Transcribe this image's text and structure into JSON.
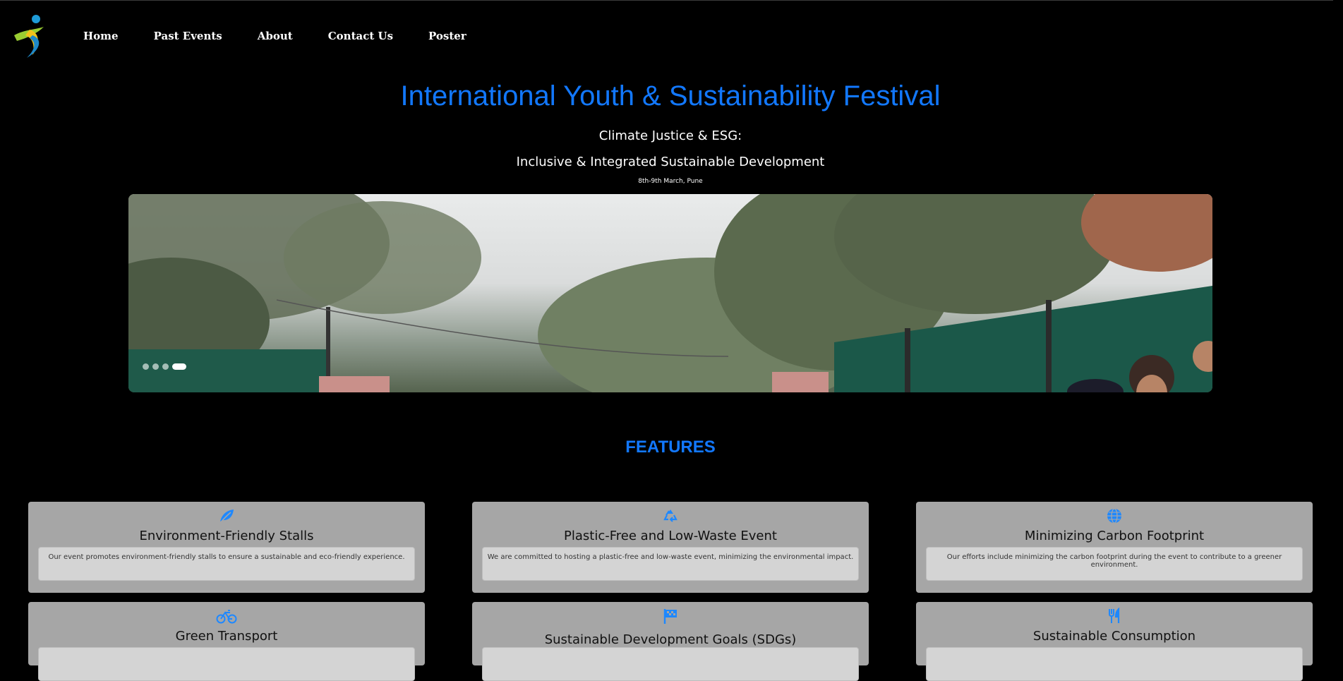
{
  "nav": {
    "links": [
      "Home",
      "Past Events",
      "About",
      "Contact Us",
      "Poster"
    ]
  },
  "hero": {
    "title": "International Youth & Sustainability Festival",
    "subtitle1": "Climate Justice & ESG:",
    "subtitle2": "Inclusive & Integrated Sustainable Development",
    "date": "8th-9th March, Pune"
  },
  "carousel": {
    "slide_count": 4,
    "active_index": 3
  },
  "features": {
    "heading": "FEATURES",
    "accent_color": "#1278ff",
    "items": [
      {
        "icon": "leaf-icon",
        "title": "Environment-Friendly Stalls",
        "desc": "Our event promotes environment-friendly stalls to ensure a sustainable and eco-friendly experience."
      },
      {
        "icon": "recycle-icon",
        "title": "Plastic-Free and Low-Waste Event",
        "desc": "We are committed to hosting a plastic-free and low-waste event, minimizing the environmental impact."
      },
      {
        "icon": "globe-icon",
        "title": "Minimizing Carbon Footprint",
        "desc": "Our efforts include minimizing the carbon footprint during the event to contribute to a greener environment."
      },
      {
        "icon": "bicycle-icon",
        "title": "Green Transport",
        "desc": ""
      },
      {
        "icon": "flag-icon",
        "title": "Sustainable Development Goals (SDGs)",
        "desc": ""
      },
      {
        "icon": "utensils-icon",
        "title": "Sustainable Consumption",
        "desc": ""
      }
    ]
  }
}
